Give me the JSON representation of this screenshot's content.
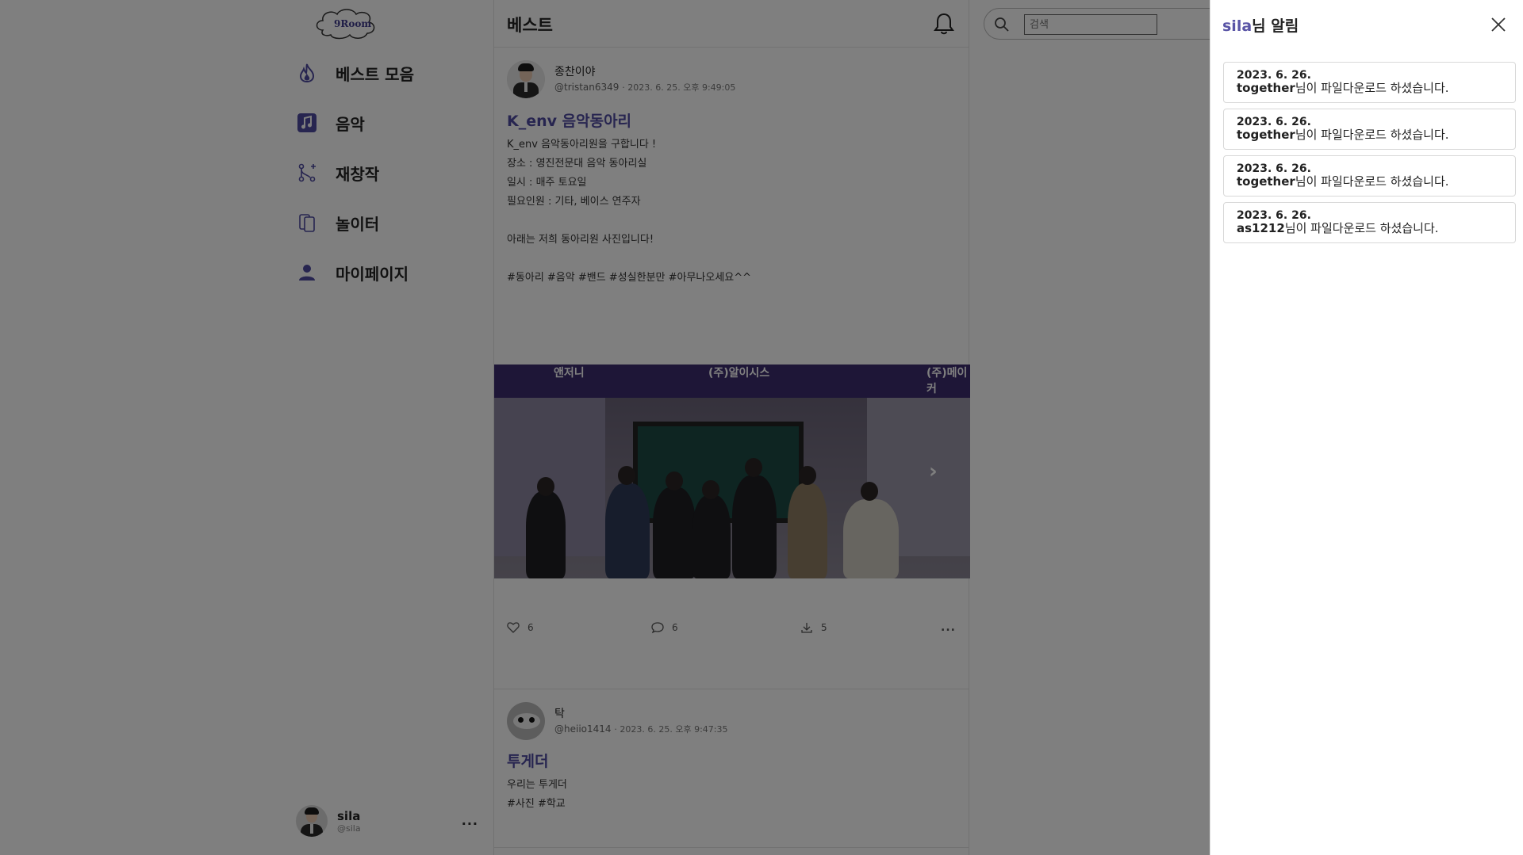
{
  "logo": {
    "text": "9Room"
  },
  "sidebar": {
    "items": [
      {
        "label": "베스트 모음",
        "icon": "flame-icon"
      },
      {
        "label": "음악",
        "icon": "music-note-icon"
      },
      {
        "label": "재창작",
        "icon": "git-merge-icon"
      },
      {
        "label": "놀이터",
        "icon": "cards-icon"
      },
      {
        "label": "마이페이지",
        "icon": "user-icon"
      }
    ],
    "profile": {
      "name": "sila",
      "handle": "@sila",
      "more": "..."
    }
  },
  "feed": {
    "title": "베스트",
    "posts": [
      {
        "author": "종찬이야",
        "handle": "@tristan6349",
        "date": "· 2023. 6. 25. 오후 9:49:05",
        "title": "K_env 음악동아리",
        "body": [
          "K_env 음악동아리원을 구합니다 !",
          "장소 : 영진전문대 음악 동아리실",
          "일시 : 매주 토요일",
          "필요인원 : 기타, 베이스 연주자",
          "",
          "아래는 저희 동아리원 사진입니다!",
          "",
          "#동아리 #음악 #밴드 #성실한분만 #아무나오세요^^"
        ],
        "image_banner": [
          "앤저니",
          "(주)알이시스",
          "(주)메이커"
        ],
        "likes": "6",
        "comments": "6",
        "downloads": "5",
        "more": "..."
      },
      {
        "author": "탁",
        "handle": "@heiio1414",
        "date": "· 2023. 6. 25. 오후 9:47:35",
        "title": "투게더",
        "body": [
          "우리는 투게더",
          "#사진 #학교"
        ]
      }
    ]
  },
  "search": {
    "placeholder": "검색"
  },
  "notifications": {
    "user": "sila",
    "title_suffix": "님 알림",
    "items": [
      {
        "date": "2023. 6. 26.",
        "who": "together",
        "msg": "님이 파일다운로드 하셨습니다."
      },
      {
        "date": "2023. 6. 26.",
        "who": "together",
        "msg": "님이 파일다운로드 하셨습니다."
      },
      {
        "date": "2023. 6. 26.",
        "who": "together",
        "msg": "님이 파일다운로드 하셨습니다."
      },
      {
        "date": "2023. 6. 26.",
        "who": "as1212",
        "msg": "님이 파일다운로드 하셨습니다."
      }
    ]
  },
  "colors": {
    "accent": "#5a55a6",
    "overlay": "rgba(0,0,0,0.5)"
  }
}
